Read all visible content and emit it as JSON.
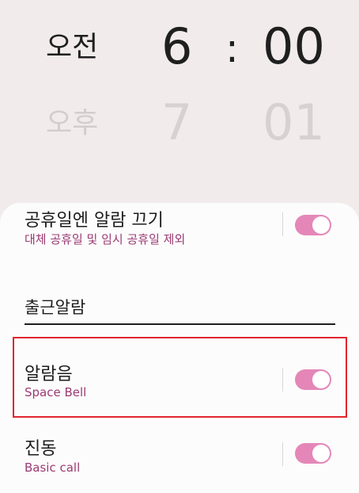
{
  "time_picker": {
    "ampm_selected": "오전",
    "hour_selected": "6",
    "separator": ":",
    "minute_selected": "00",
    "ampm_next": "오후",
    "hour_next": "7",
    "minute_next": "01"
  },
  "settings": {
    "holiday_off": {
      "title": "공휴일엔 알람 끄기",
      "subtitle": "대체 공휴일 및 임시 공휴일 제외",
      "enabled": true
    },
    "alarm_name": {
      "value": "출근알람"
    },
    "alarm_sound": {
      "title": "알람음",
      "subtitle": "Space Bell",
      "enabled": true
    },
    "vibration": {
      "title": "진동",
      "subtitle": "Basic call",
      "enabled": true
    }
  },
  "colors": {
    "accent": "#e487b8",
    "subtitle": "#9a3b73",
    "highlight_border": "#e0262e"
  }
}
